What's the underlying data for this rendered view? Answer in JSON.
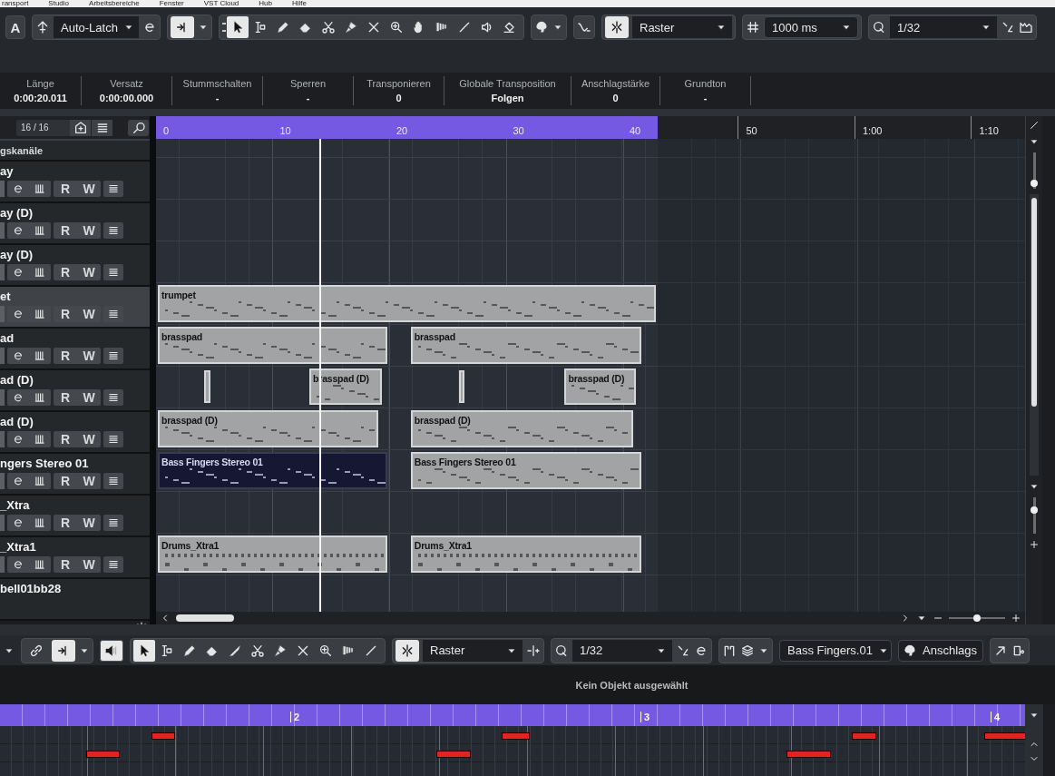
{
  "menu_bar": [
    "ransport",
    "Studio",
    "Arbeitsbereiche",
    "Fenster",
    "VST Cloud",
    "Hub",
    "Hilfe"
  ],
  "toolbar": {
    "constrain_button": "A",
    "automation_mode": "Auto-Latch",
    "autoscroll": {
      "on": true
    },
    "tools": [
      {
        "selected": true
      },
      {
        "selected": false
      },
      {
        "selected": false
      },
      {
        "selected": false
      },
      {
        "selected": false
      },
      {
        "selected": false
      },
      {
        "selected": false
      },
      {
        "selected": false
      },
      {
        "selected": false
      },
      {
        "selected": false
      },
      {
        "selected": false
      },
      {
        "selected": false
      },
      {
        "selected": false
      }
    ],
    "snap": {
      "on": true
    },
    "snap_type": "Raster",
    "grid": "1000 ms",
    "quantize": "1/32"
  },
  "info_line": [
    {
      "label": "Länge",
      "value": "0:00:20.011"
    },
    {
      "label": "Versatz",
      "value": "0:00:00.000"
    },
    {
      "label": "Stummschalten",
      "value": "-"
    },
    {
      "label": "Sperren",
      "value": "-"
    },
    {
      "label": "Transponieren",
      "value": "0"
    },
    {
      "label": "Globale Transposition",
      "value": "Folgen"
    },
    {
      "label": "Anschlagstärke",
      "value": "0"
    },
    {
      "label": "Grundton",
      "value": "-"
    }
  ],
  "track_list": {
    "count": "16 / 16",
    "folder": "gskanäle",
    "tracks": [
      {
        "name": "ay",
        "selected": false,
        "read": "R",
        "write": "W"
      },
      {
        "name": "ay (D)",
        "selected": false,
        "read": "R",
        "write": "W"
      },
      {
        "name": "ay (D)",
        "selected": false,
        "read": "R",
        "write": "W"
      },
      {
        "name": "et",
        "selected": true,
        "read": "R",
        "write": "W",
        "events": [
          {
            "name": "trumpet",
            "selected": false
          }
        ]
      },
      {
        "name": "ad",
        "selected": false,
        "read": "R",
        "write": "W",
        "events": [
          {
            "name": "brasspad",
            "selected": false
          },
          {
            "name": "brasspad",
            "selected": false
          }
        ]
      },
      {
        "name": "ad (D)",
        "selected": false,
        "read": "R",
        "write": "W",
        "events": [
          {
            "selected": false
          },
          {
            "name": "brasspad (D)",
            "selected": false
          },
          {
            "selected": false
          },
          {
            "name": "brasspad (D)",
            "selected": false
          }
        ]
      },
      {
        "name": "ad (D)",
        "selected": false,
        "read": "R",
        "write": "W",
        "events": [
          {
            "name": "brasspad (D)",
            "selected": false
          },
          {
            "name": "brasspad (D)",
            "selected": false
          }
        ]
      },
      {
        "name": "ngers Stereo 01",
        "selected": false,
        "read": "R",
        "write": "W",
        "events": [
          {
            "name": "Bass Fingers Stereo 01",
            "selected": true
          },
          {
            "name": "Bass Fingers Stereo 01",
            "selected": false
          }
        ]
      },
      {
        "name": "_Xtra",
        "selected": false,
        "read": "R",
        "write": "W"
      },
      {
        "name": "_Xtra1",
        "selected": false,
        "read": "R",
        "write": "W",
        "events": [
          {
            "name": "Drums_Xtra1",
            "selected": false
          },
          {
            "name": "Drums_Xtra1",
            "selected": false
          }
        ]
      },
      {
        "name": "bell01bb28",
        "selected": false
      }
    ]
  },
  "track_zoom": {
    "level": 0.05
  },
  "height_zoom": {
    "level": 0.7
  },
  "horizontal_zoom": {
    "level": 0.5
  },
  "ruler": {
    "labels": [
      "0",
      "10",
      "20",
      "30",
      "40",
      "50",
      "1:00",
      "1:10"
    ]
  },
  "editor": {
    "toolbar": {
      "link": {
        "on": false
      },
      "autoscroll": {
        "on": true
      },
      "feedback": {
        "on": true
      },
      "tools": [
        {
          "selected": true
        },
        {
          "selected": false
        },
        {
          "selected": false
        },
        {
          "selected": false
        },
        {
          "selected": false
        },
        {
          "selected": false
        },
        {
          "selected": false
        },
        {
          "selected": false
        },
        {
          "selected": false
        },
        {
          "selected": false
        },
        {
          "selected": false
        }
      ],
      "snap": {
        "on": true
      },
      "snap_type": "Raster",
      "quantize": "1/32",
      "part": "Bass Fingers.01",
      "lane": "Anschlags"
    },
    "status": "Kein Objekt ausgewählt",
    "ruler_labels": [
      "2",
      "3",
      "4"
    ]
  }
}
